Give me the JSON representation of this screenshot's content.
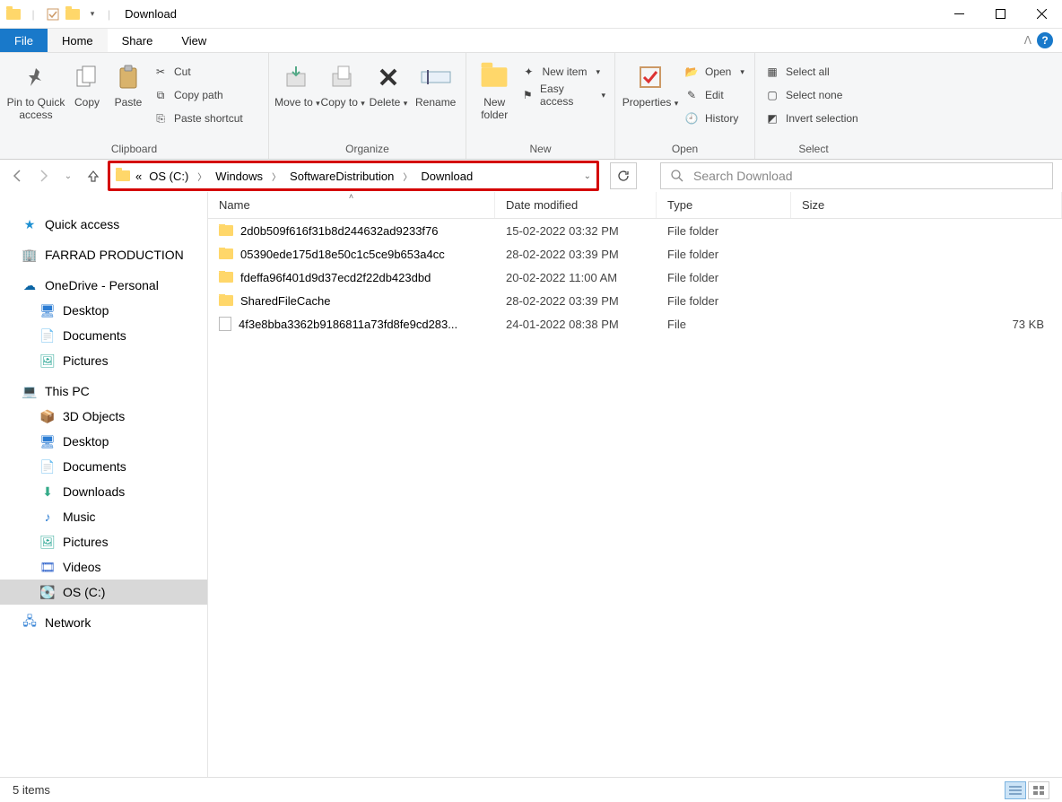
{
  "window": {
    "title": "Download"
  },
  "tabs": {
    "file": "File",
    "home": "Home",
    "share": "Share",
    "view": "View"
  },
  "ribbon": {
    "pin": "Pin to Quick access",
    "copy": "Copy",
    "paste": "Paste",
    "cut": "Cut",
    "copypath": "Copy path",
    "pasteshortcut": "Paste shortcut",
    "moveto": "Move to",
    "copyto": "Copy to",
    "delete": "Delete",
    "rename": "Rename",
    "newfolder": "New folder",
    "newitem": "New item",
    "easyaccess": "Easy access",
    "properties": "Properties",
    "open": "Open",
    "edit": "Edit",
    "history": "History",
    "selectall": "Select all",
    "selectnone": "Select none",
    "invertselection": "Invert selection",
    "groups": {
      "clipboard": "Clipboard",
      "organize": "Organize",
      "new": "New",
      "open": "Open",
      "select": "Select"
    }
  },
  "breadcrumb": [
    "OS (C:)",
    "Windows",
    "SoftwareDistribution",
    "Download"
  ],
  "search_placeholder": "Search Download",
  "columns": {
    "name": "Name",
    "date": "Date modified",
    "type": "Type",
    "size": "Size"
  },
  "files": [
    {
      "icon": "folder",
      "name": "2d0b509f616f31b8d244632ad9233f76",
      "date": "15-02-2022 03:32 PM",
      "type": "File folder",
      "size": ""
    },
    {
      "icon": "folder",
      "name": "05390ede175d18e50c1c5ce9b653a4cc",
      "date": "28-02-2022 03:39 PM",
      "type": "File folder",
      "size": ""
    },
    {
      "icon": "folder",
      "name": "fdeffa96f401d9d37ecd2f22db423dbd",
      "date": "20-02-2022 11:00 AM",
      "type": "File folder",
      "size": ""
    },
    {
      "icon": "folder",
      "name": "SharedFileCache",
      "date": "28-02-2022 03:39 PM",
      "type": "File folder",
      "size": ""
    },
    {
      "icon": "file",
      "name": "4f3e8bba3362b9186811a73fd8fe9cd283...",
      "date": "24-01-2022 08:38 PM",
      "type": "File",
      "size": "73 KB"
    }
  ],
  "sidebar": {
    "quickaccess": "Quick access",
    "farrad": "FARRAD PRODUCTION",
    "onedrive": "OneDrive - Personal",
    "od_desktop": "Desktop",
    "od_documents": "Documents",
    "od_pictures": "Pictures",
    "thispc": "This PC",
    "pc_3d": "3D Objects",
    "pc_desktop": "Desktop",
    "pc_documents": "Documents",
    "pc_downloads": "Downloads",
    "pc_music": "Music",
    "pc_pictures": "Pictures",
    "pc_videos": "Videos",
    "pc_os": "OS (C:)",
    "network": "Network"
  },
  "status": {
    "items": "5 items"
  }
}
